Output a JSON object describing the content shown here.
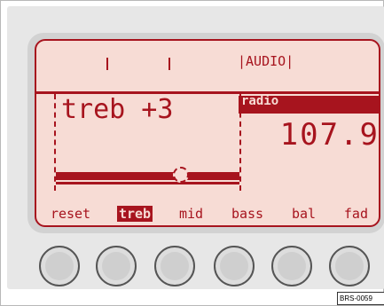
{
  "header": {
    "mode_label": "|AUDIO|"
  },
  "adjust": {
    "text": "treb +3",
    "level": 0.68
  },
  "radio": {
    "label": "radio",
    "frequency": "107.9"
  },
  "functions": [
    {
      "label": "reset",
      "active": false
    },
    {
      "label": "treb",
      "active": true
    },
    {
      "label": "mid",
      "active": false
    },
    {
      "label": "bass",
      "active": false
    },
    {
      "label": "bal",
      "active": false
    },
    {
      "label": "fad",
      "active": false
    }
  ],
  "figure_id": "BRS-0059",
  "colors": {
    "display_bg": "#f7dcd5",
    "display_fg": "#a7141e",
    "bezel": "#e7e7e7"
  }
}
